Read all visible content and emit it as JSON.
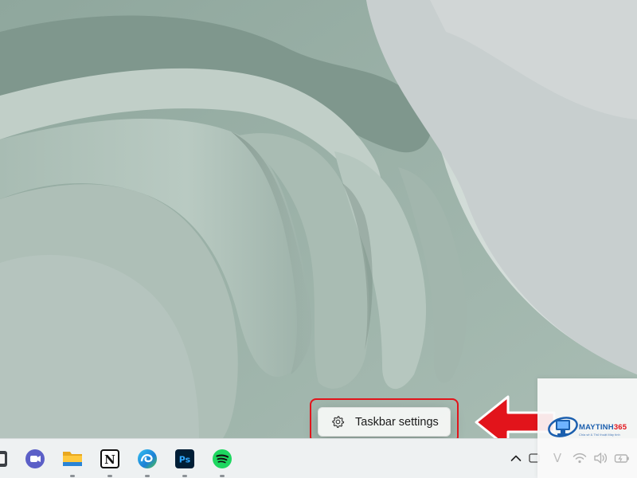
{
  "context_menu": {
    "items": [
      {
        "label": "Taskbar settings",
        "icon": "gear-icon"
      }
    ]
  },
  "annotation": {
    "highlight_color": "#e2141b"
  },
  "taskbar": {
    "apps": [
      {
        "name": "partially-visible-app-icon"
      },
      {
        "name": "teams-icon",
        "running": false
      },
      {
        "name": "file-explorer-icon",
        "running": true
      },
      {
        "name": "notion-icon",
        "running": true,
        "glyph": "N"
      },
      {
        "name": "edge-icon",
        "running": true
      },
      {
        "name": "photoshop-icon",
        "running": true,
        "glyph": "Ps"
      },
      {
        "name": "spotify-icon",
        "running": true
      }
    ],
    "tray": [
      {
        "name": "show-hidden-icons-chevron-icon"
      },
      {
        "name": "partially-hidden-tray-icon"
      },
      {
        "name": "vietnamese-input-icon",
        "glyph": "V"
      },
      {
        "name": "wifi-icon"
      },
      {
        "name": "volume-icon"
      },
      {
        "name": "battery-icon"
      }
    ]
  },
  "watermark": {
    "brand_main": "MAYTINH",
    "brand_accent": "365",
    "tagline": "Chia sẻ & Thủ thuật Máy tính"
  }
}
